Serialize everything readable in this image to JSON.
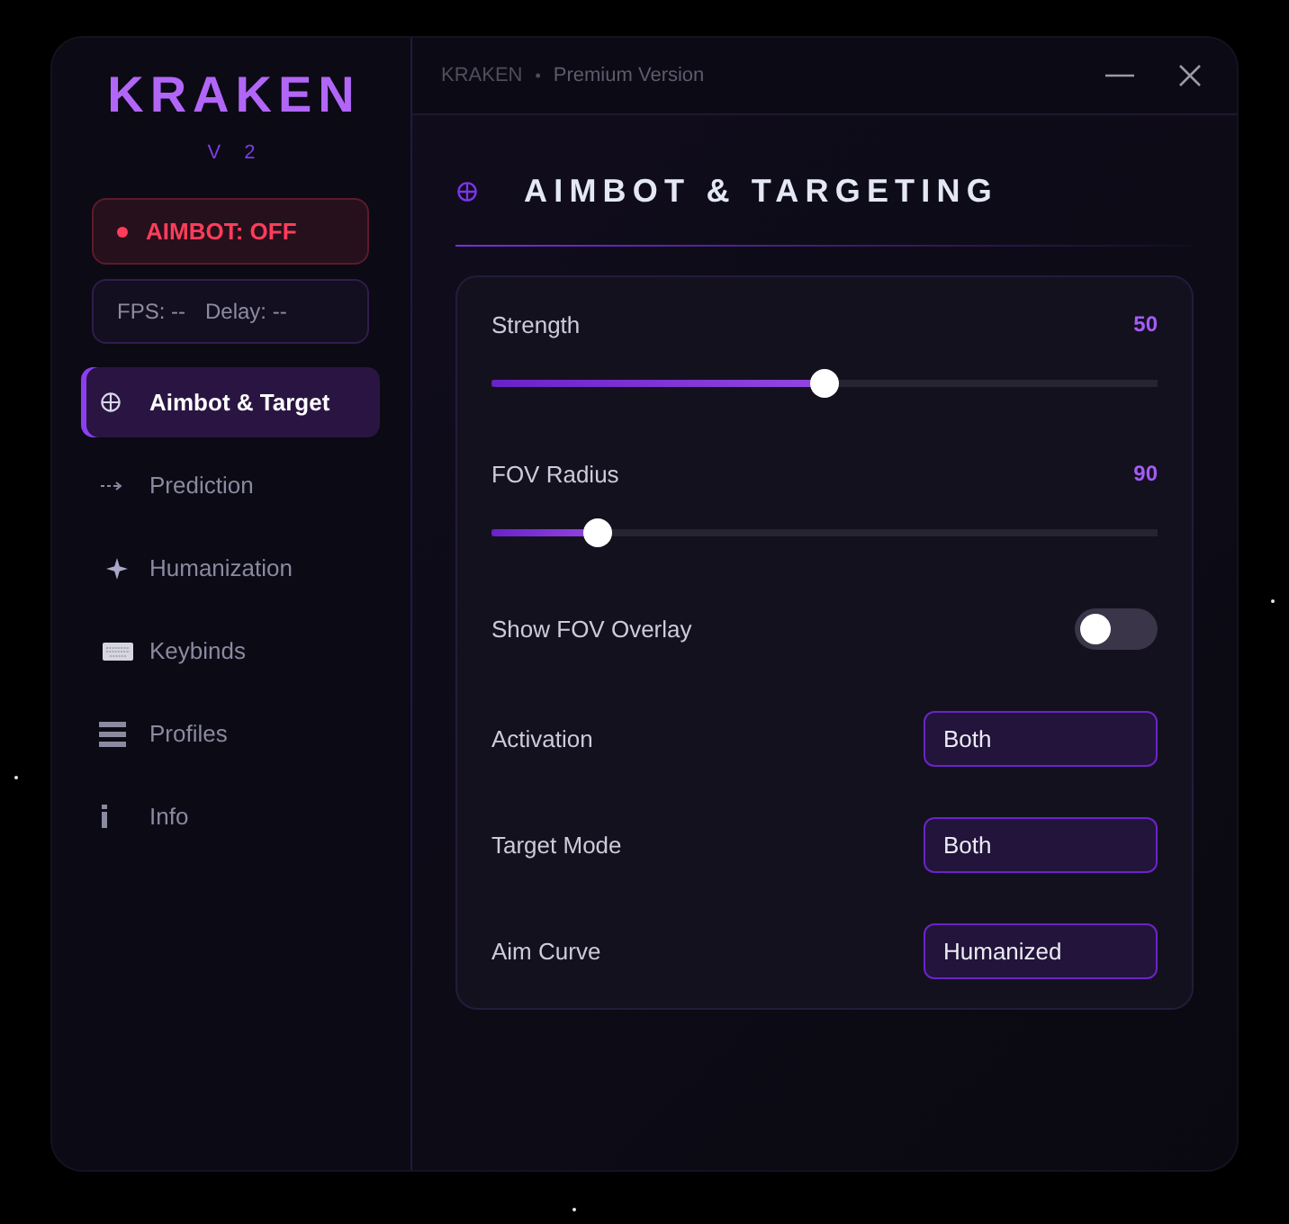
{
  "sidebar": {
    "logo": "KRAKEN",
    "version": "V 2"
  },
  "status": {
    "label": "AIMBOT: OFF",
    "on": false
  },
  "stats": [
    {
      "text": "FPS: --"
    },
    {
      "text": "Delay: --"
    }
  ],
  "nav": [
    {
      "kind": "aim",
      "label": "Aimbot & Target",
      "selected": true
    },
    {
      "kind": "prediction",
      "label": "Prediction",
      "selected": false
    },
    {
      "kind": "humanization",
      "label": "Humanization",
      "selected": false
    },
    {
      "kind": "keybinds",
      "label": "Keybinds",
      "selected": false
    },
    {
      "kind": "profiles",
      "label": "Profiles",
      "selected": false
    },
    {
      "kind": "info",
      "label": "Info",
      "selected": false
    }
  ],
  "titlebar": {
    "app": "KRAKEN",
    "separator": "•",
    "subtitle": "Premium Version"
  },
  "page": {
    "title": "AIMBOT & TARGETING"
  },
  "settings": [
    {
      "kind": "slider",
      "label": "Strength",
      "reading": "50",
      "level": 0.5
    },
    {
      "kind": "slider",
      "label": "FOV Radius",
      "reading": "90",
      "level": 0.16
    },
    {
      "kind": "toggle",
      "label": "Show FOV Overlay",
      "on": false
    },
    {
      "kind": "select",
      "label": "Activation",
      "value": "Both"
    },
    {
      "kind": "select",
      "label": "Target Mode",
      "value": "Both"
    },
    {
      "kind": "select",
      "label": "Aim Curve",
      "value": "Humanized"
    }
  ]
}
